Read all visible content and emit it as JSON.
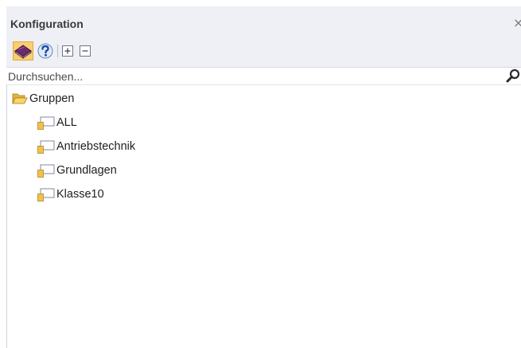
{
  "panel": {
    "title": "Konfiguration",
    "close_glyph": "×"
  },
  "toolbar": {
    "buttons": [
      {
        "name": "book",
        "icon": "book-icon",
        "active": true
      },
      {
        "name": "help",
        "icon": "help-icon"
      },
      {
        "name": "expand-all",
        "icon": "plus-box-icon"
      },
      {
        "name": "collapse-all",
        "icon": "minus-box-icon"
      }
    ]
  },
  "search": {
    "placeholder": "Durchsuchen...",
    "icon": "magnifier-icon"
  },
  "tree": {
    "root": {
      "label": "Gruppen",
      "icon": "folder-open-icon"
    },
    "children": [
      {
        "label": "ALL",
        "icon": "group-node-icon"
      },
      {
        "label": "Antriebstechnik",
        "icon": "group-node-icon"
      },
      {
        "label": "Grundlagen",
        "icon": "group-node-icon"
      },
      {
        "label": "Klasse10",
        "icon": "group-node-icon"
      }
    ]
  },
  "colors": {
    "panel_bg": "#eef0f5",
    "active_button": "#f9cf6f",
    "book": "#6b2a6e",
    "folder": "#f2c14e"
  }
}
